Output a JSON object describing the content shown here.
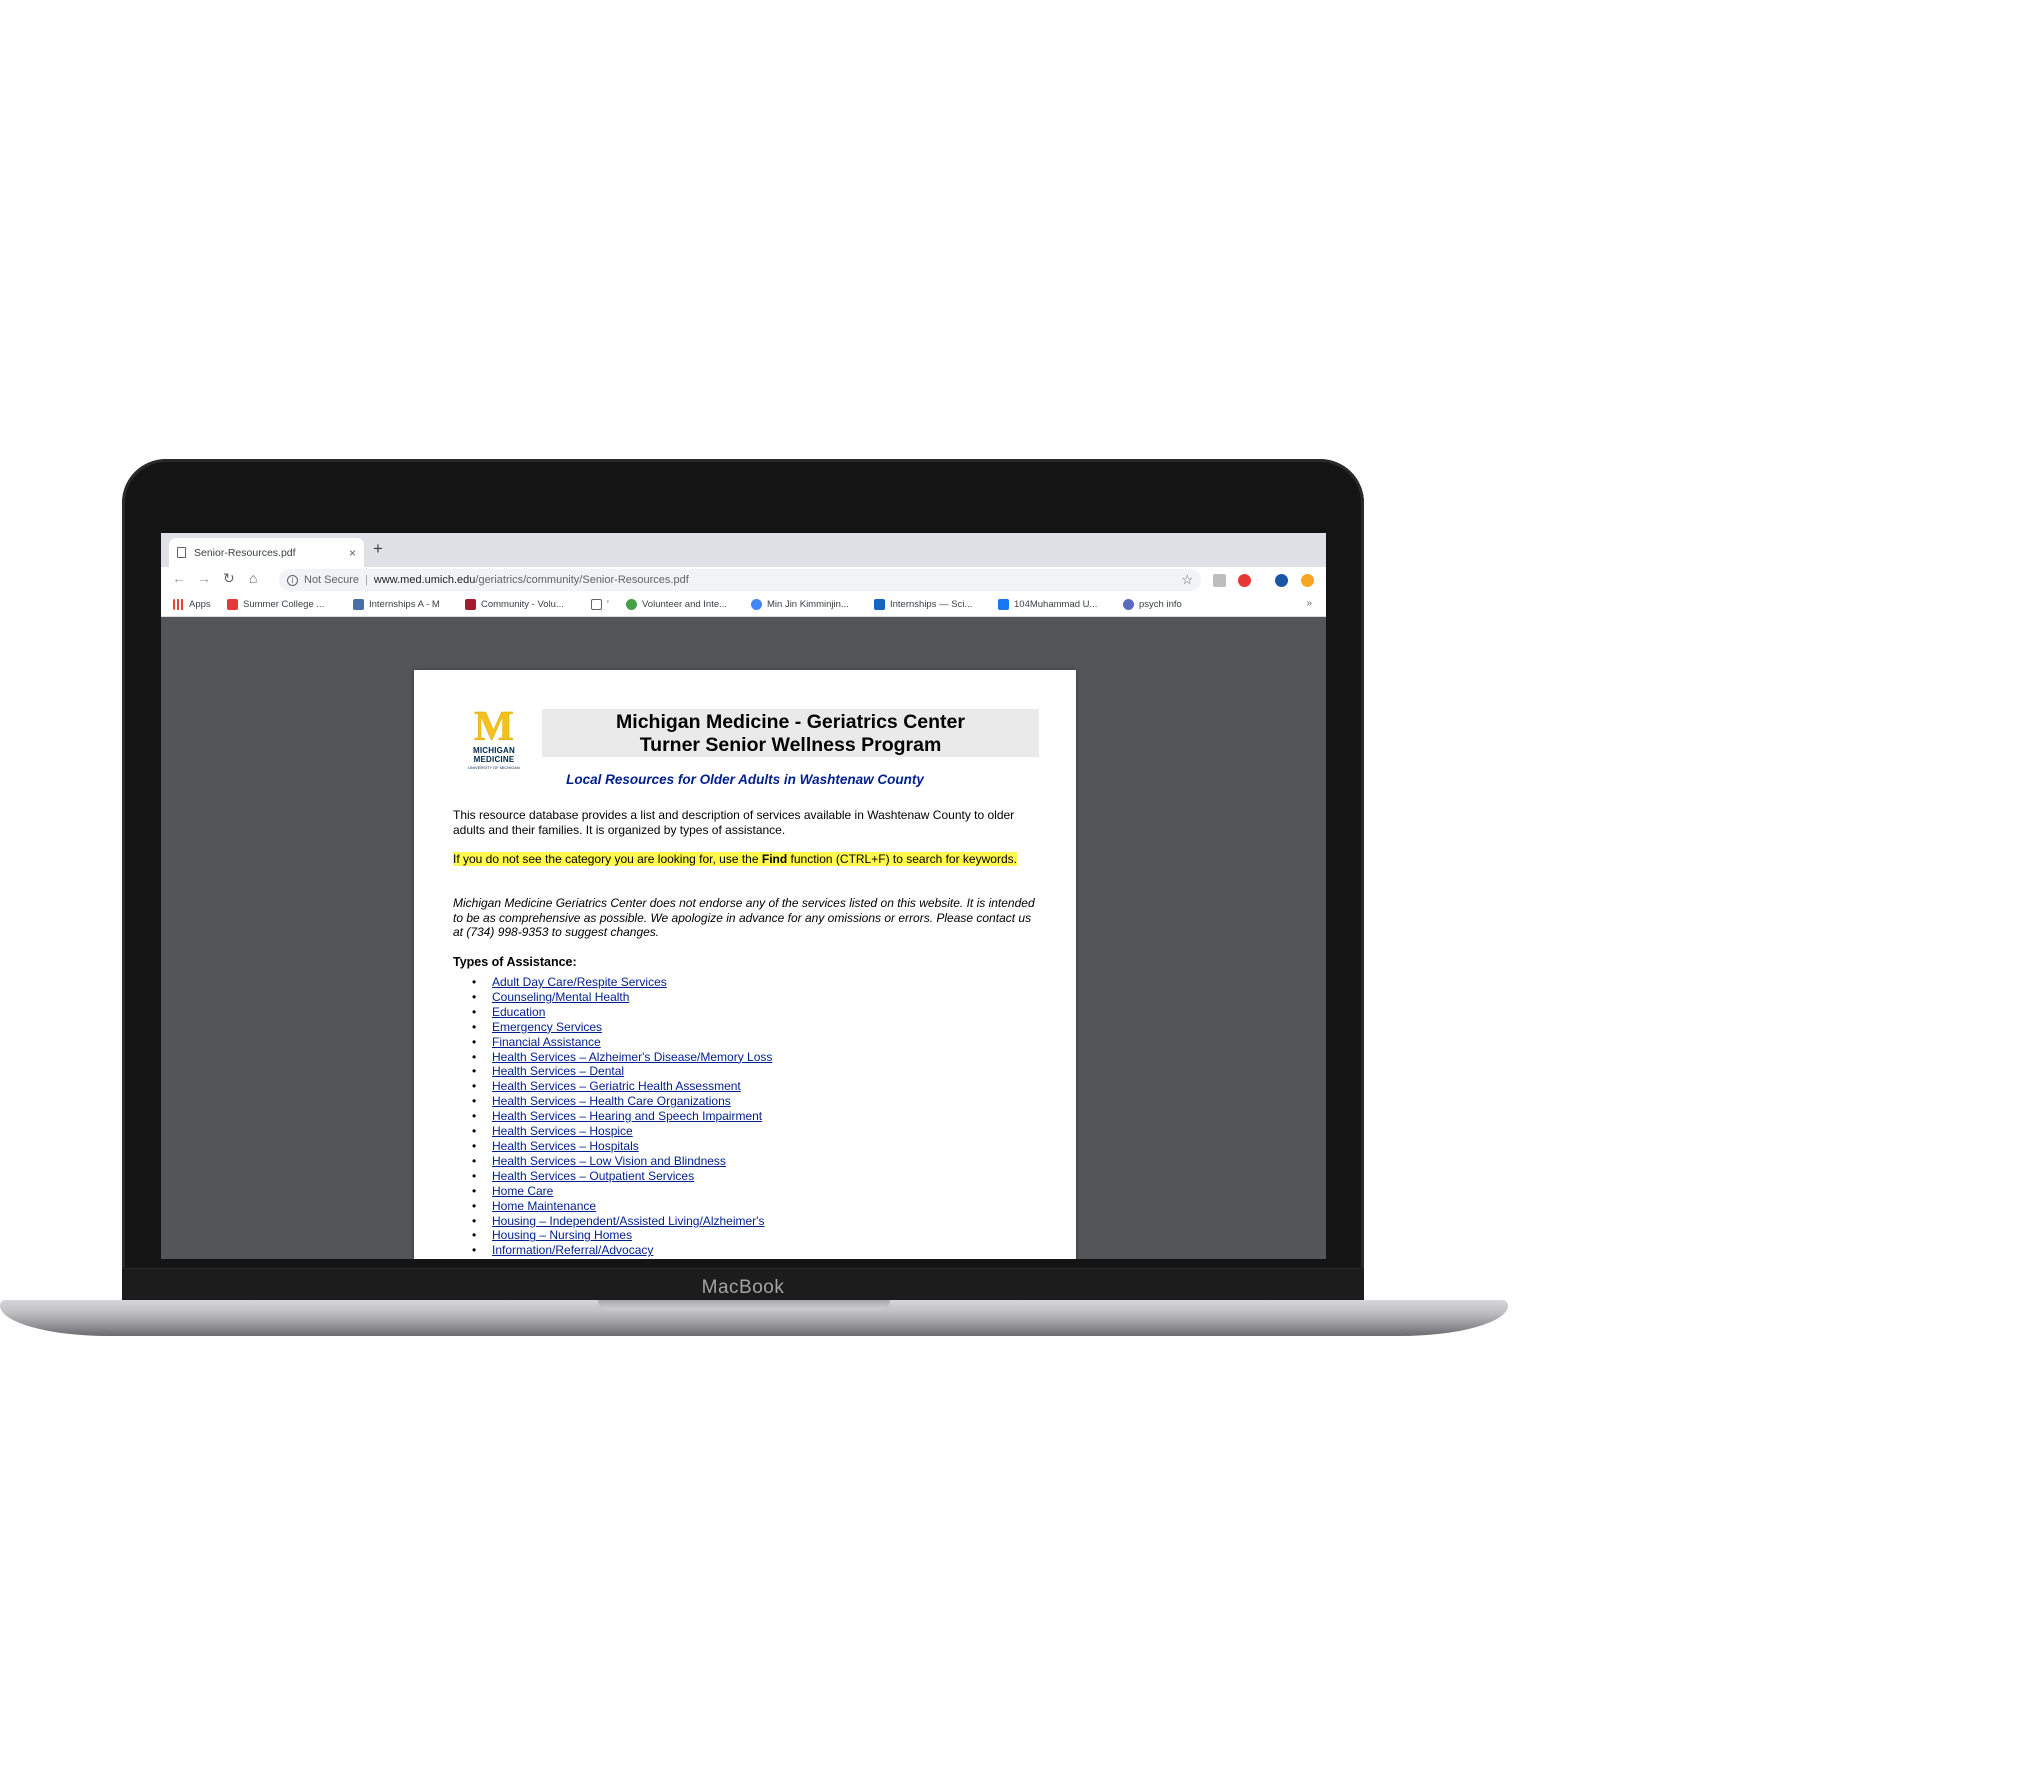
{
  "device": {
    "brand": "MacBook"
  },
  "browser": {
    "tab_title": "Senior-Resources.pdf",
    "new_tab_symbol": "+",
    "close_symbol": "×",
    "security_label": "Not Secure",
    "url_host": "www.med.umich.edu",
    "url_path": "/geriatrics/community/Senior-Resources.pdf",
    "bookmarks": [
      {
        "label": "Apps",
        "icon": "apps-grid-icon",
        "color": "#ea4335"
      },
      {
        "label": "Summer College ...",
        "icon": "nyt-icon",
        "color": "#e53935"
      },
      {
        "label": "Internships A - M",
        "icon": "crown-icon",
        "color": "#4a6fa5"
      },
      {
        "label": "Community - Volu...",
        "icon": "m-icon",
        "color": "#a6192e"
      },
      {
        "label": "'",
        "icon": "page-icon",
        "color": "#5f6368"
      },
      {
        "label": "Volunteer and Inte...",
        "icon": "leaf-icon",
        "color": "#43a047"
      },
      {
        "label": "Min Jin Kimminjin...",
        "icon": "google-icon",
        "color": "#4285f4"
      },
      {
        "label": "Internships — Sci...",
        "icon": "x-icon",
        "color": "#1565c0"
      },
      {
        "label": "104Muhammad U...",
        "icon": "facebook-icon",
        "color": "#1877f2"
      },
      {
        "label": "psych info",
        "icon": "info-icon",
        "color": "#5c6bc0"
      }
    ],
    "more_bookmarks": "»",
    "extensions": [
      {
        "name": "extension-gray-icon",
        "color": "#bdbdbd"
      },
      {
        "name": "extension-red-icon",
        "color": "#e53935"
      },
      {
        "name": "profile-avatar-icon",
        "color": "#1a56a6"
      },
      {
        "name": "notification-icon",
        "color": "#f5a623"
      }
    ]
  },
  "pdf": {
    "logo_letter": "M",
    "logo_name": "MICHIGAN MEDICINE",
    "logo_sub": "UNIVERSITY OF MICHIGAN",
    "title_line1": "Michigan Medicine - Geriatrics Center",
    "title_line2": "Turner Senior Wellness Program",
    "subtitle": "Local Resources for Older Adults in Washtenaw County",
    "intro": "This resource database provides a list and description of services available in Washtenaw County to older adults and their families. It is organized by types of assistance.",
    "find_pre": "If you do not see the category you are looking for, use the ",
    "find_bold": "Find",
    "find_post": " function (CTRL+F) to search for keywords.",
    "disclaimer": "Michigan Medicine Geriatrics Center does not endorse any of the services listed on this website. It is intended to be as comprehensive as possible.  We apologize in advance for any omissions or errors. Please contact us at (734) 998-9353 to suggest changes.",
    "types_heading": "Types of Assistance:",
    "types": [
      "Adult Day Care/Respite Services",
      "Counseling/Mental Health",
      "Education",
      "Emergency Services",
      "Financial Assistance",
      "Health Services – Alzheimer's Disease/Memory Loss",
      "Health Services – Dental",
      "Health Services – Geriatric Health Assessment",
      "Health Services – Health Care Organizations",
      "Health Services – Hearing and Speech Impairment",
      "Health Services – Hospice",
      "Health Services – Hospitals",
      "Health Services – Low Vision and Blindness",
      "Health Services – Outpatient Services",
      "Home Care",
      "Home Maintenance",
      "Housing – Independent/Assisted Living/Alzheimer's",
      "Housing – Nursing Homes",
      "Information/Referral/Advocacy"
    ]
  },
  "colors": {
    "link": "#001f8f",
    "highlight": "#fff84d",
    "michigan_maize": "#f4c21e",
    "michigan_blue": "#00274c"
  }
}
